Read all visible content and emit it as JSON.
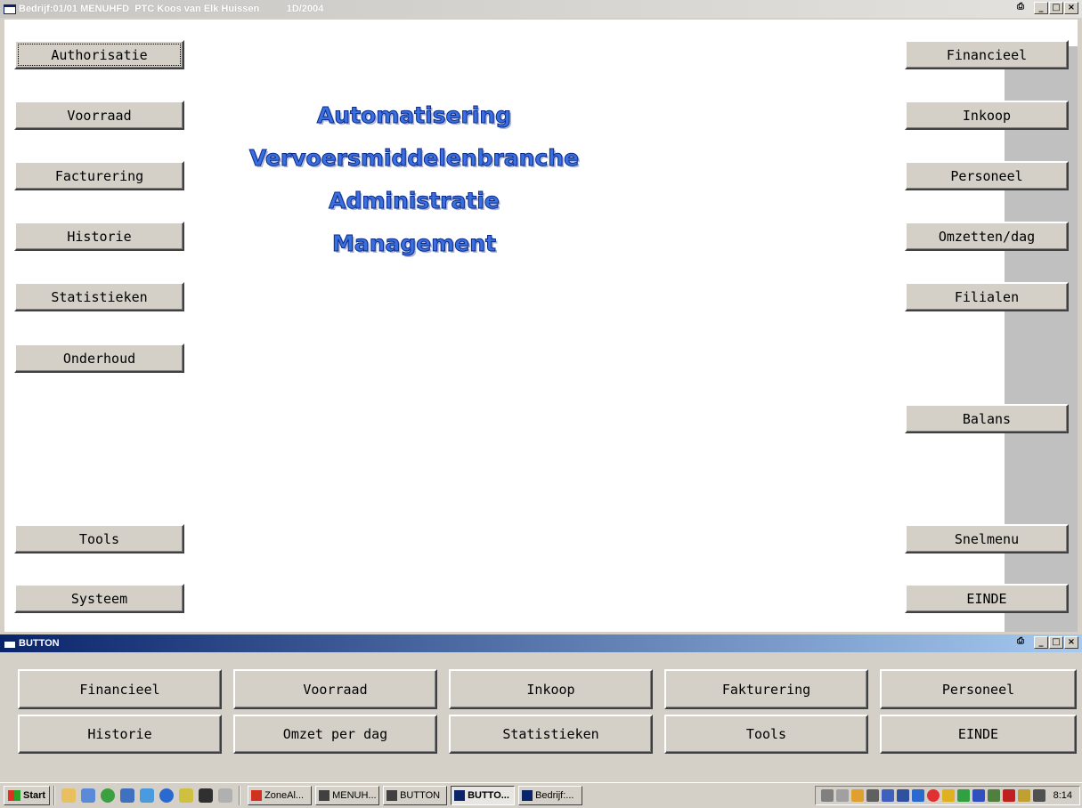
{
  "main_window": {
    "title": "Bedrijf:01/01 MENUHFD  PTC Koos van Elk Huissen          1D/2004"
  },
  "left_menu": [
    {
      "label": "Authorisatie"
    },
    {
      "label": "Voorraad"
    },
    {
      "label": "Facturering"
    },
    {
      "label": "Historie"
    },
    {
      "label": "Statistieken"
    },
    {
      "label": "Onderhoud"
    },
    {
      "label": "Tools"
    },
    {
      "label": "Systeem"
    }
  ],
  "right_menu": [
    {
      "label": "Financieel"
    },
    {
      "label": "Inkoop"
    },
    {
      "label": "Personeel"
    },
    {
      "label": "Omzetten/dag"
    },
    {
      "label": "Filialen"
    },
    {
      "label": "Balans"
    },
    {
      "label": "Snelmenu"
    },
    {
      "label": "EINDE"
    }
  ],
  "headline": [
    "Automatisering",
    "Vervoersmiddelenbranche",
    "Administratie",
    "Management"
  ],
  "button_window": {
    "title": "BUTTON",
    "row1": [
      "Financieel",
      "Voorraad",
      "Inkoop",
      "Fakturering",
      "Personeel"
    ],
    "row2": [
      "Historie",
      "Omzet per dag",
      "Statistieken",
      "Tools",
      "EINDE"
    ]
  },
  "taskbar": {
    "start_label": "Start",
    "tasks": [
      "ZoneAl...",
      "MENUH...",
      "BUTTON",
      "BUTTO...",
      "Bedrijf:..."
    ],
    "clock": "8:14"
  },
  "colors": {
    "accent": "#0a246a",
    "headline": "#3a6fe0"
  }
}
